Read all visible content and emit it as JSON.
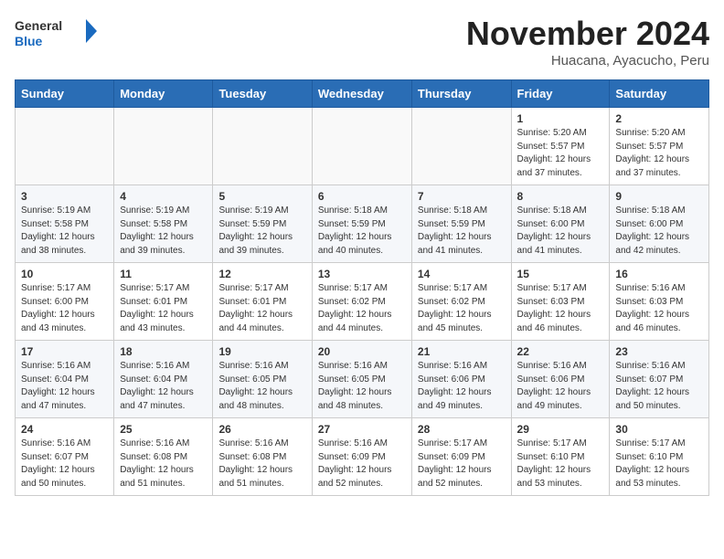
{
  "header": {
    "logo_general": "General",
    "logo_blue": "Blue",
    "month_title": "November 2024",
    "location": "Huacana, Ayacucho, Peru"
  },
  "days_of_week": [
    "Sunday",
    "Monday",
    "Tuesday",
    "Wednesday",
    "Thursday",
    "Friday",
    "Saturday"
  ],
  "weeks": [
    [
      {
        "num": "",
        "info": ""
      },
      {
        "num": "",
        "info": ""
      },
      {
        "num": "",
        "info": ""
      },
      {
        "num": "",
        "info": ""
      },
      {
        "num": "",
        "info": ""
      },
      {
        "num": "1",
        "info": "Sunrise: 5:20 AM\nSunset: 5:57 PM\nDaylight: 12 hours\nand 37 minutes."
      },
      {
        "num": "2",
        "info": "Sunrise: 5:20 AM\nSunset: 5:57 PM\nDaylight: 12 hours\nand 37 minutes."
      }
    ],
    [
      {
        "num": "3",
        "info": "Sunrise: 5:19 AM\nSunset: 5:58 PM\nDaylight: 12 hours\nand 38 minutes."
      },
      {
        "num": "4",
        "info": "Sunrise: 5:19 AM\nSunset: 5:58 PM\nDaylight: 12 hours\nand 39 minutes."
      },
      {
        "num": "5",
        "info": "Sunrise: 5:19 AM\nSunset: 5:59 PM\nDaylight: 12 hours\nand 39 minutes."
      },
      {
        "num": "6",
        "info": "Sunrise: 5:18 AM\nSunset: 5:59 PM\nDaylight: 12 hours\nand 40 minutes."
      },
      {
        "num": "7",
        "info": "Sunrise: 5:18 AM\nSunset: 5:59 PM\nDaylight: 12 hours\nand 41 minutes."
      },
      {
        "num": "8",
        "info": "Sunrise: 5:18 AM\nSunset: 6:00 PM\nDaylight: 12 hours\nand 41 minutes."
      },
      {
        "num": "9",
        "info": "Sunrise: 5:18 AM\nSunset: 6:00 PM\nDaylight: 12 hours\nand 42 minutes."
      }
    ],
    [
      {
        "num": "10",
        "info": "Sunrise: 5:17 AM\nSunset: 6:00 PM\nDaylight: 12 hours\nand 43 minutes."
      },
      {
        "num": "11",
        "info": "Sunrise: 5:17 AM\nSunset: 6:01 PM\nDaylight: 12 hours\nand 43 minutes."
      },
      {
        "num": "12",
        "info": "Sunrise: 5:17 AM\nSunset: 6:01 PM\nDaylight: 12 hours\nand 44 minutes."
      },
      {
        "num": "13",
        "info": "Sunrise: 5:17 AM\nSunset: 6:02 PM\nDaylight: 12 hours\nand 44 minutes."
      },
      {
        "num": "14",
        "info": "Sunrise: 5:17 AM\nSunset: 6:02 PM\nDaylight: 12 hours\nand 45 minutes."
      },
      {
        "num": "15",
        "info": "Sunrise: 5:17 AM\nSunset: 6:03 PM\nDaylight: 12 hours\nand 46 minutes."
      },
      {
        "num": "16",
        "info": "Sunrise: 5:16 AM\nSunset: 6:03 PM\nDaylight: 12 hours\nand 46 minutes."
      }
    ],
    [
      {
        "num": "17",
        "info": "Sunrise: 5:16 AM\nSunset: 6:04 PM\nDaylight: 12 hours\nand 47 minutes."
      },
      {
        "num": "18",
        "info": "Sunrise: 5:16 AM\nSunset: 6:04 PM\nDaylight: 12 hours\nand 47 minutes."
      },
      {
        "num": "19",
        "info": "Sunrise: 5:16 AM\nSunset: 6:05 PM\nDaylight: 12 hours\nand 48 minutes."
      },
      {
        "num": "20",
        "info": "Sunrise: 5:16 AM\nSunset: 6:05 PM\nDaylight: 12 hours\nand 48 minutes."
      },
      {
        "num": "21",
        "info": "Sunrise: 5:16 AM\nSunset: 6:06 PM\nDaylight: 12 hours\nand 49 minutes."
      },
      {
        "num": "22",
        "info": "Sunrise: 5:16 AM\nSunset: 6:06 PM\nDaylight: 12 hours\nand 49 minutes."
      },
      {
        "num": "23",
        "info": "Sunrise: 5:16 AM\nSunset: 6:07 PM\nDaylight: 12 hours\nand 50 minutes."
      }
    ],
    [
      {
        "num": "24",
        "info": "Sunrise: 5:16 AM\nSunset: 6:07 PM\nDaylight: 12 hours\nand 50 minutes."
      },
      {
        "num": "25",
        "info": "Sunrise: 5:16 AM\nSunset: 6:08 PM\nDaylight: 12 hours\nand 51 minutes."
      },
      {
        "num": "26",
        "info": "Sunrise: 5:16 AM\nSunset: 6:08 PM\nDaylight: 12 hours\nand 51 minutes."
      },
      {
        "num": "27",
        "info": "Sunrise: 5:16 AM\nSunset: 6:09 PM\nDaylight: 12 hours\nand 52 minutes."
      },
      {
        "num": "28",
        "info": "Sunrise: 5:17 AM\nSunset: 6:09 PM\nDaylight: 12 hours\nand 52 minutes."
      },
      {
        "num": "29",
        "info": "Sunrise: 5:17 AM\nSunset: 6:10 PM\nDaylight: 12 hours\nand 53 minutes."
      },
      {
        "num": "30",
        "info": "Sunrise: 5:17 AM\nSunset: 6:10 PM\nDaylight: 12 hours\nand 53 minutes."
      }
    ]
  ]
}
